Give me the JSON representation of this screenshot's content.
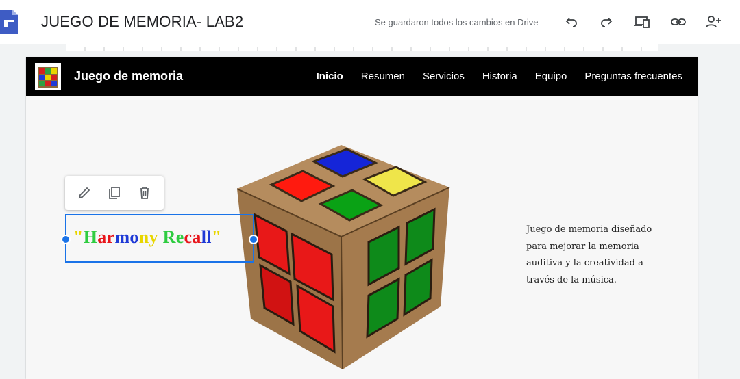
{
  "editor": {
    "doc_title": "JUEGO DE MEMORIA- LAB2",
    "save_status": "Se guardaron todos los cambios en Drive",
    "toolbar_icons": [
      "undo-icon",
      "redo-icon",
      "preview-icon",
      "link-icon",
      "share-icon"
    ]
  },
  "site": {
    "name": "Juego de memoria",
    "nav": [
      {
        "label": "Inicio",
        "active": true
      },
      {
        "label": "Resumen"
      },
      {
        "label": "Servicios"
      },
      {
        "label": "Historia"
      },
      {
        "label": "Equipo"
      },
      {
        "label": "Preguntas frecuentes"
      }
    ],
    "hero": {
      "title_letters": [
        {
          "ch": "\"",
          "color": "#e8d600"
        },
        {
          "ch": "H",
          "color": "#2ecc40"
        },
        {
          "ch": "a",
          "color": "#e8151b"
        },
        {
          "ch": "r",
          "color": "#e8151b"
        },
        {
          "ch": "m",
          "color": "#1f3ad6"
        },
        {
          "ch": "o",
          "color": "#1f3ad6"
        },
        {
          "ch": "n",
          "color": "#e8d600"
        },
        {
          "ch": "y",
          "color": "#e8d600"
        },
        {
          "ch": " ",
          "color": "#000000"
        },
        {
          "ch": "R",
          "color": "#2ecc40"
        },
        {
          "ch": "e",
          "color": "#2ecc40"
        },
        {
          "ch": "c",
          "color": "#e8151b"
        },
        {
          "ch": "a",
          "color": "#e8151b"
        },
        {
          "ch": "l",
          "color": "#1f3ad6"
        },
        {
          "ch": "l",
          "color": "#1f3ad6"
        },
        {
          "ch": "\"",
          "color": "#e8d600"
        }
      ],
      "description": "Juego de memoria diseñado para mejorar la memoria auditiva y la creatividad a través de la música."
    }
  }
}
